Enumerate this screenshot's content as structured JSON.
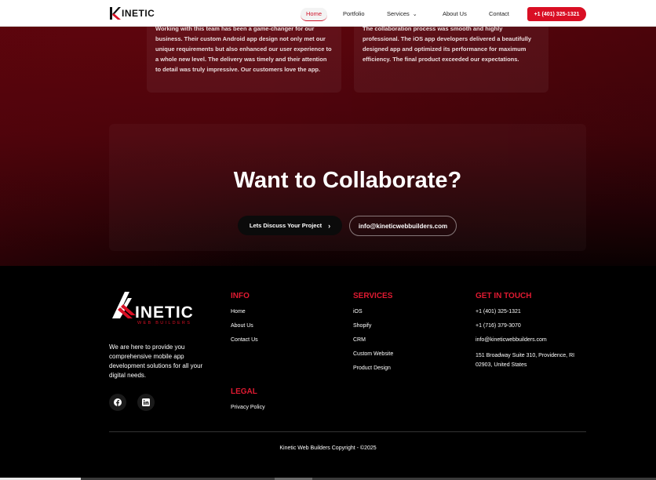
{
  "nav": {
    "logo_text": "INETIC",
    "links": [
      "Home",
      "Portfolio",
      "Services",
      "About Us",
      "Contact"
    ],
    "phone": "+1 (401) 325-1321"
  },
  "testimonials": [
    {
      "text": "Working with this team has been a game-changer for our business. Their custom Android app design not only met our unique requirements but also enhanced our user experience to a whole new level. The delivery was timely and their attention to detail was truly impressive. Our customers love the app."
    },
    {
      "text": "The collaboration process was smooth and highly professional. The iOS app developers delivered a beautifully designed app and optimized its performance for maximum efficiency. The final product exceeded our expectations."
    }
  ],
  "cta": {
    "title": "Want to Collaborate?",
    "discuss_label": "Lets Discuss Your Project",
    "email": "info@kineticwebbuilders.com"
  },
  "footer": {
    "logo_text": "INETIC",
    "logo_sub": "WEB BUILDERS",
    "description": "We are here to provide you comprehensive mobile app development solutions for all your digital needs.",
    "info": {
      "heading": "INFO",
      "items": [
        "Home",
        "About Us",
        "Contact Us"
      ]
    },
    "legal": {
      "heading": "LEGAL",
      "items": [
        "Privacy Policy"
      ]
    },
    "services": {
      "heading": "SERVICES",
      "items": [
        "iOS",
        "Shopify",
        "CRM",
        "Custom Website",
        "Product Design"
      ]
    },
    "contact": {
      "heading": "GET IN TOUCH",
      "phone1": "+1 (401) 325-1321",
      "phone2": "+1 (716) 379-3070",
      "email": "info@kineticwebbuilders.com",
      "address": "151 Broadway Suite 310, Providence, RI 02903, United States"
    },
    "social": [
      "facebook-icon",
      "linkedin-icon"
    ],
    "copyright": "Kinetic Web Builders Copyright - ©2025"
  },
  "colors": {
    "accent": "#d90f24",
    "hero_dark": "#5e050d"
  }
}
